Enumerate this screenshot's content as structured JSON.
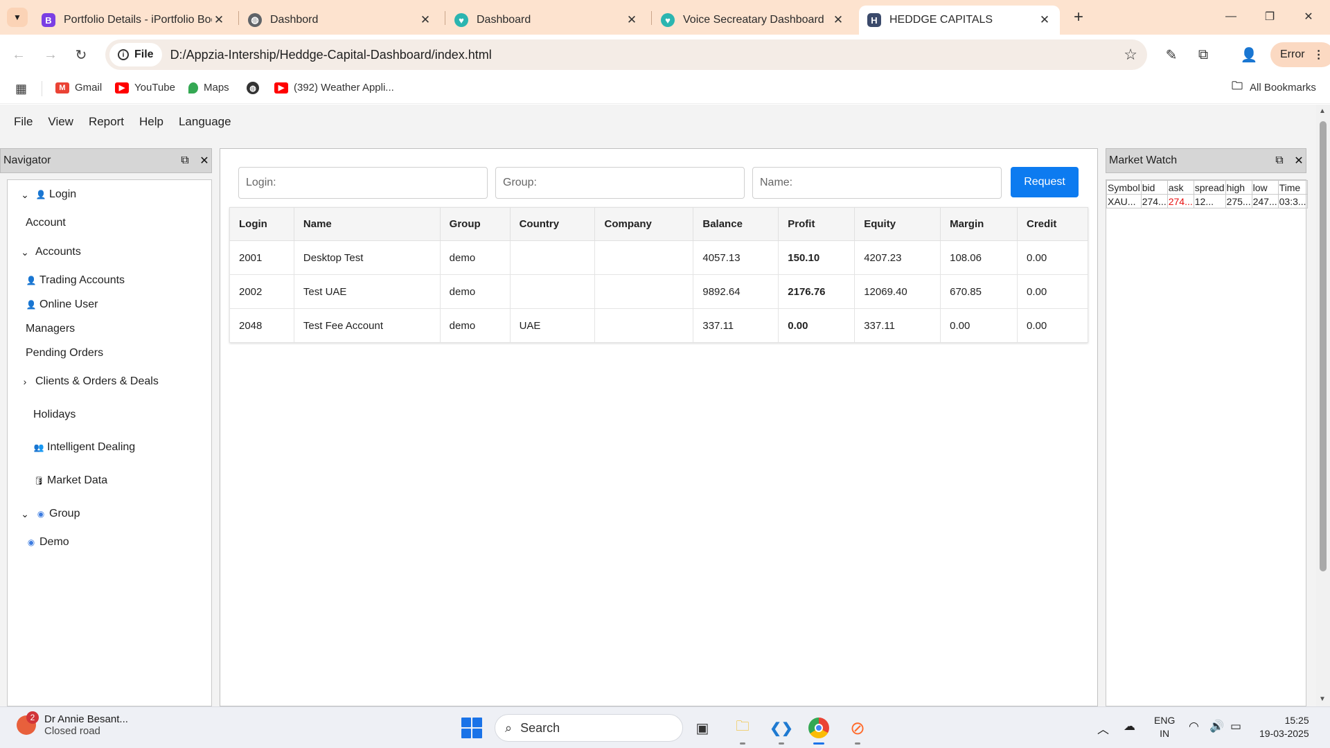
{
  "browser": {
    "tabs": [
      {
        "title": "Portfolio Details - iPortfolio Bootstrap",
        "icon": "bootstrap-icon",
        "color": "#7b3fe4"
      },
      {
        "title": "Dashbord",
        "icon": "globe-icon",
        "color": "#5f6368"
      },
      {
        "title": "Dashboard",
        "icon": "heart-icon",
        "color": "#2bb5b0"
      },
      {
        "title": "Voice Secreatary Dashboard",
        "icon": "heart-icon",
        "color": "#2bb5b0"
      },
      {
        "title": "HEDDGE CAPITALS",
        "icon": "logo-icon",
        "color": "#3b4a6b"
      }
    ],
    "url_chip": "File",
    "url": "D:/Appzia-Intership/Heddge-Capital-Dashboard/index.html",
    "error_label": "Error",
    "bookmarks": [
      {
        "label": "Gmail"
      },
      {
        "label": "YouTube"
      },
      {
        "label": "Maps"
      },
      {
        "label": "(392) Weather Appli..."
      }
    ],
    "all_bookmarks": "All Bookmarks"
  },
  "menu": [
    "File",
    "View",
    "Report",
    "Help",
    "Language"
  ],
  "navigator": {
    "title": "Navigator",
    "items": {
      "login": "Login",
      "account": "Account",
      "accounts": "Accounts",
      "trading_accounts": "Trading Accounts",
      "online_user": "Online User",
      "managers": "Managers",
      "pending_orders": "Pending Orders",
      "clients_orders_deals": "Clients & Orders & Deals",
      "holidays": "Holidays",
      "intelligent_dealing": "Intelligent Dealing",
      "market_data": "Market Data",
      "group": "Group",
      "demo": "Demo"
    }
  },
  "filters": {
    "login_placeholder": "Login:",
    "group_placeholder": "Group:",
    "name_placeholder": "Name:",
    "request_label": "Request"
  },
  "accounts_table": {
    "columns": [
      "Login",
      "Name",
      "Group",
      "Country",
      "Company",
      "Balance",
      "Profit",
      "Equity",
      "Margin",
      "Credit"
    ],
    "rows": [
      [
        "2001",
        "Desktop Test",
        "demo",
        "",
        "",
        "4057.13",
        "150.10",
        "4207.23",
        "108.06",
        "0.00"
      ],
      [
        "2002",
        "Test UAE",
        "demo",
        "",
        "",
        "9892.64",
        "2176.76",
        "12069.40",
        "670.85",
        "0.00"
      ],
      [
        "2048",
        "Test Fee Account",
        "demo",
        "UAE",
        "",
        "337.11",
        "0.00",
        "337.11",
        "0.00",
        "0.00"
      ]
    ],
    "colors": {
      "profit_positive": "#0a8a0a",
      "profit_zero": "#e81010"
    }
  },
  "market_watch": {
    "title": "Market Watch",
    "columns": [
      "Symbol",
      "bid",
      "ask",
      "spread",
      "high",
      "low",
      "Time"
    ],
    "rows": [
      [
        "XAU...",
        "274...",
        "274...",
        "12...",
        "275...",
        "247...",
        "03:3..."
      ]
    ]
  },
  "taskbar": {
    "weather_title": "Dr Annie Besant...",
    "weather_sub": "Closed road",
    "notification_count": "2",
    "search_label": "Search",
    "lang_line1": "ENG",
    "lang_line2": "IN",
    "time": "15:25",
    "date": "19-03-2025"
  }
}
